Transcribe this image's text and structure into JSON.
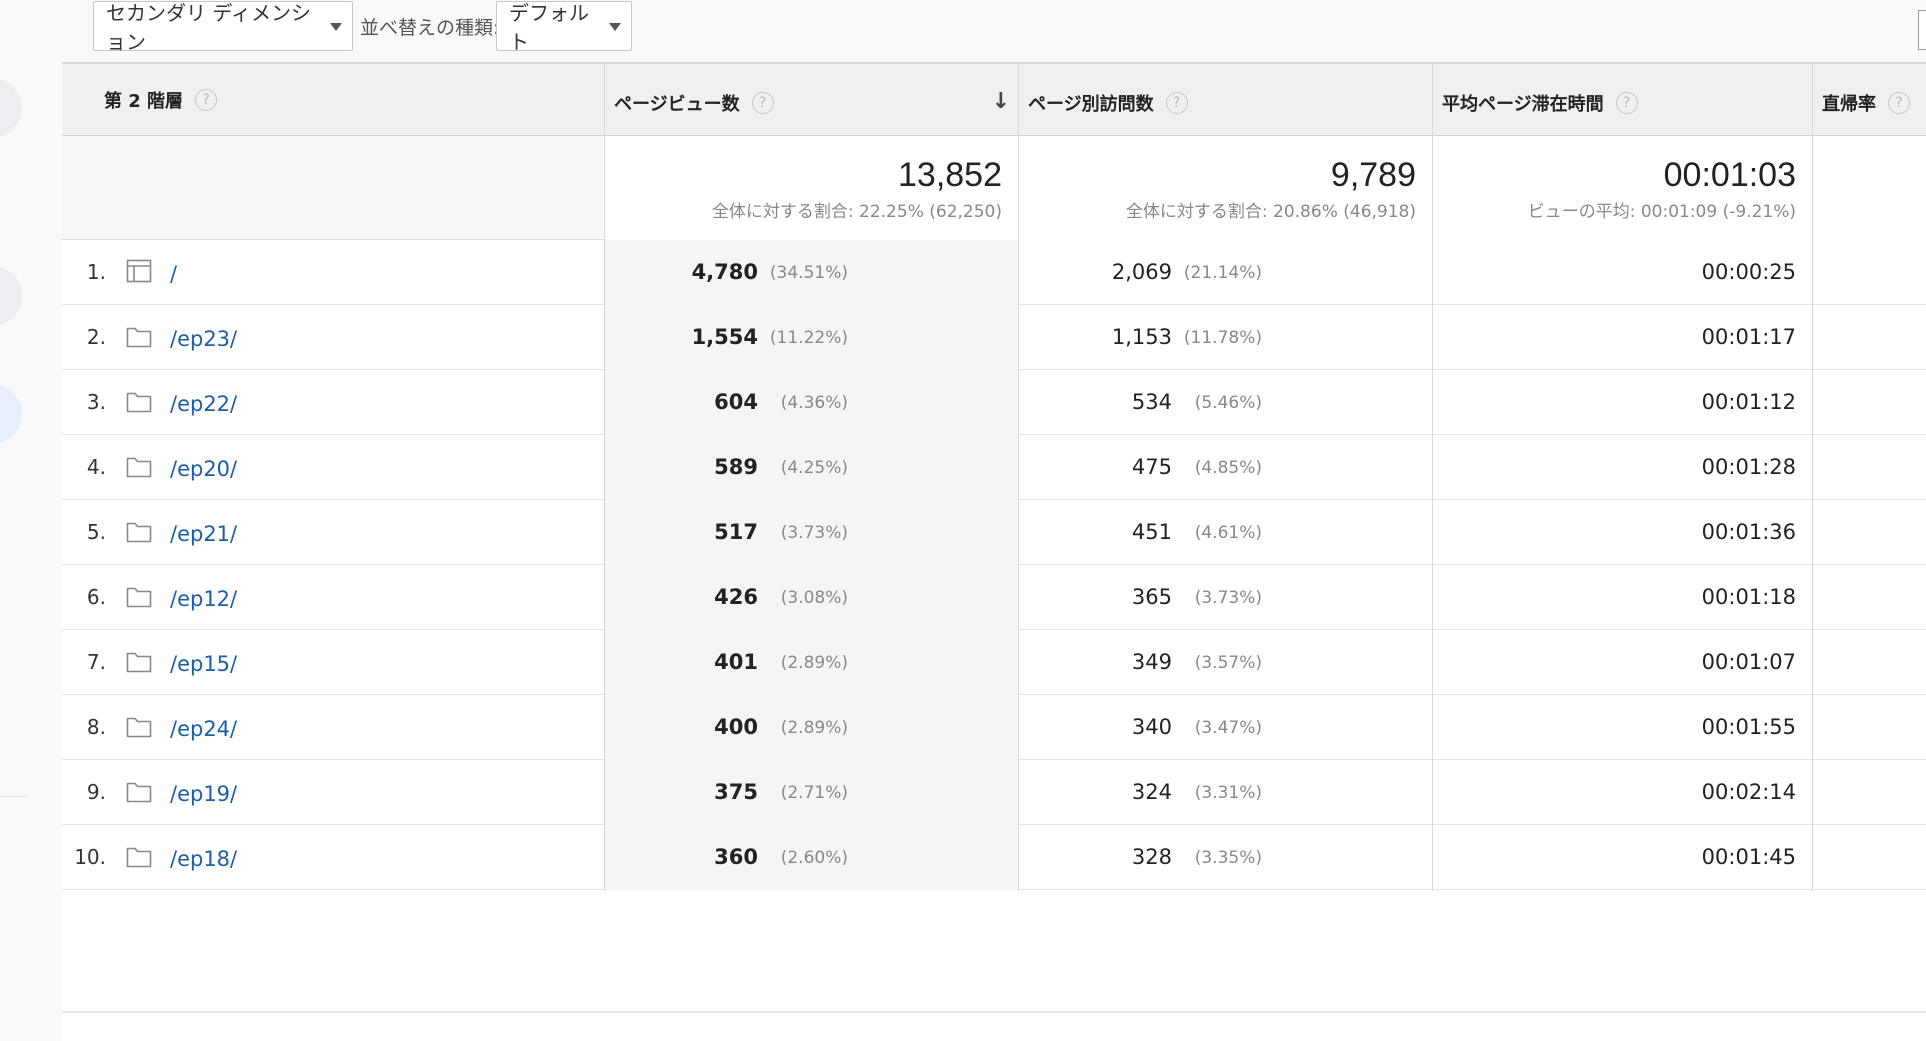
{
  "toolbar": {
    "secondary_dimension": "セカンダリ ディメンション",
    "sort_type_label": "並べ替えの種類:",
    "sort_type_value": "デフォルト"
  },
  "columns": {
    "dimension": "第 2 階層",
    "pageviews": "ページビュー数",
    "unique_pageviews": "ページ別訪問数",
    "avg_time": "平均ページ滞在時間",
    "bounce_rate": "直帰率",
    "help": "?"
  },
  "summary": {
    "pageviews": "13,852",
    "pageviews_sub": "全体に対する割合: 22.25% (62,250)",
    "unique_pageviews": "9,789",
    "unique_pageviews_sub": "全体に対する割合: 20.86% (46,918)",
    "avg_time": "00:01:03",
    "avg_time_sub": "ビューの平均: 00:01:09 (-9.21%)"
  },
  "rows": [
    {
      "idx": "1.",
      "icon": "page-icon",
      "path": "/",
      "pv": "4,780",
      "pv_pct": "(34.51%)",
      "upv": "2,069",
      "upv_pct": "(21.14%)",
      "time": "00:00:25"
    },
    {
      "idx": "2.",
      "icon": "folder-icon",
      "path": "/ep23/",
      "pv": "1,554",
      "pv_pct": "(11.22%)",
      "upv": "1,153",
      "upv_pct": "(11.78%)",
      "time": "00:01:17"
    },
    {
      "idx": "3.",
      "icon": "folder-icon",
      "path": "/ep22/",
      "pv": "604",
      "pv_pct": "(4.36%)",
      "upv": "534",
      "upv_pct": "(5.46%)",
      "time": "00:01:12"
    },
    {
      "idx": "4.",
      "icon": "folder-icon",
      "path": "/ep20/",
      "pv": "589",
      "pv_pct": "(4.25%)",
      "upv": "475",
      "upv_pct": "(4.85%)",
      "time": "00:01:28"
    },
    {
      "idx": "5.",
      "icon": "folder-icon",
      "path": "/ep21/",
      "pv": "517",
      "pv_pct": "(3.73%)",
      "upv": "451",
      "upv_pct": "(4.61%)",
      "time": "00:01:36"
    },
    {
      "idx": "6.",
      "icon": "folder-icon",
      "path": "/ep12/",
      "pv": "426",
      "pv_pct": "(3.08%)",
      "upv": "365",
      "upv_pct": "(3.73%)",
      "time": "00:01:18"
    },
    {
      "idx": "7.",
      "icon": "folder-icon",
      "path": "/ep15/",
      "pv": "401",
      "pv_pct": "(2.89%)",
      "upv": "349",
      "upv_pct": "(3.57%)",
      "time": "00:01:07"
    },
    {
      "idx": "8.",
      "icon": "folder-icon",
      "path": "/ep24/",
      "pv": "400",
      "pv_pct": "(2.89%)",
      "upv": "340",
      "upv_pct": "(3.47%)",
      "time": "00:01:55"
    },
    {
      "idx": "9.",
      "icon": "folder-icon",
      "path": "/ep19/",
      "pv": "375",
      "pv_pct": "(2.71%)",
      "upv": "324",
      "upv_pct": "(3.31%)",
      "time": "00:02:14"
    },
    {
      "idx": "10.",
      "icon": "folder-icon",
      "path": "/ep18/",
      "pv": "360",
      "pv_pct": "(2.60%)",
      "upv": "328",
      "upv_pct": "(3.35%)",
      "time": "00:01:45"
    }
  ],
  "colors": {
    "link": "#1a5fa8",
    "header_bg": "#f0f0f0",
    "muted": "#888888"
  }
}
